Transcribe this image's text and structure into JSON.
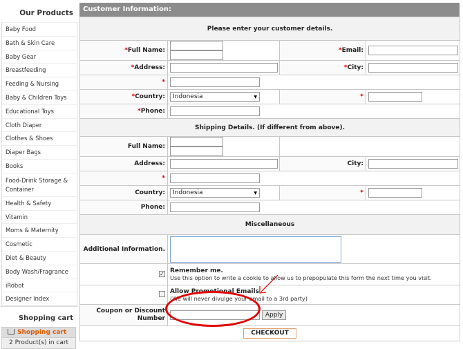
{
  "sidebar": {
    "products_title": "Our Products",
    "categories": [
      "Baby Food",
      "Bath & Skin Care",
      "Baby Gear",
      "Breastfeeding",
      "Feeding & Nursing",
      "Baby & Children Toys",
      "Educational Toys",
      "Cloth Diaper",
      "Clothes & Shoes",
      "Diaper Bags",
      "Books",
      "Food-Drink Storage & Container",
      "Health & Safety",
      "Vitamin",
      "Moms & Maternity",
      "Cosmetic",
      "Diet & Beauty",
      "Body Wash/Fragrance",
      "iRobot",
      "Designer Index"
    ],
    "cart_title": "Shopping cart",
    "cart_link": "Shopping cart",
    "cart_count": "2 Product(s) in cart"
  },
  "form": {
    "title": "Customer Information:",
    "customer_header": "Please enter your customer details.",
    "shipping_header": "Shipping Details. (If different from above).",
    "misc_header": "Miscellaneous",
    "req_mark": "*",
    "labels": {
      "full_name": "Full Name:",
      "email": "Email:",
      "address": "Address:",
      "city": "City:",
      "country": "Country:",
      "phone": "Phone:",
      "additional_info": "Additional Information.",
      "coupon": "Coupon or Discount Number"
    },
    "country_value": "Indonesia",
    "shipping_country_value": "Indonesia",
    "remember_title": "Remember me.",
    "remember_desc": "Use this option to write a cookie to allow us to prepopulate this form the next time you visit.",
    "promo_title": "Allow Promotional Emails",
    "promo_desc": "(We will never divulge your email to a 3rd party)",
    "apply_label": "Apply",
    "checkout_label": "CHECKOUT",
    "remember_checked": true,
    "promo_checked": false
  },
  "colors": {
    "title_bar": "#8c8c8c",
    "required": "#dd0000",
    "cart_link": "#e05b00",
    "annotation": "#e00000"
  }
}
